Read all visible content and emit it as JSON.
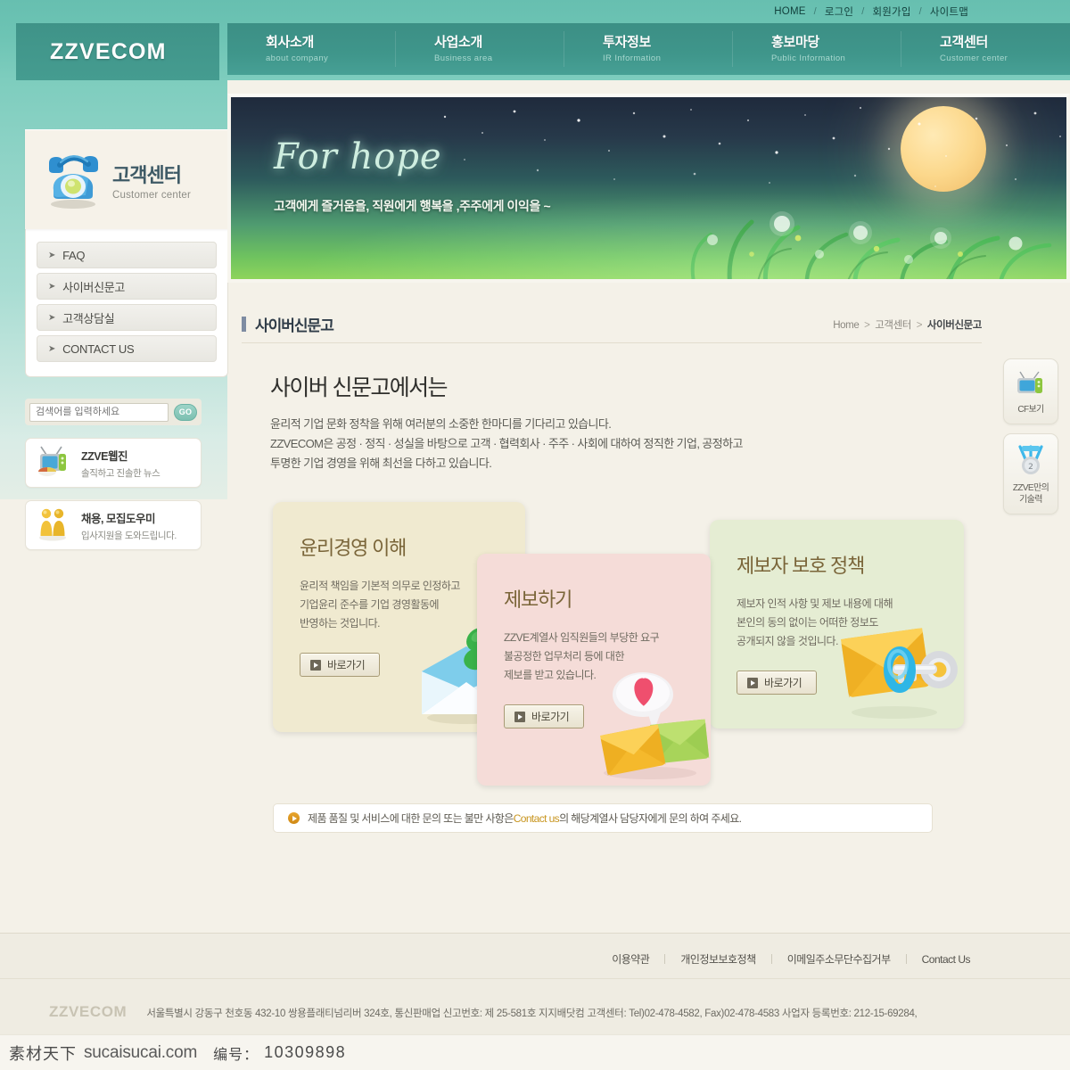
{
  "site": {
    "logo": "ZZVECOM",
    "footer_logo": "ZZVECOM"
  },
  "utility_nav": [
    {
      "label": "HOME"
    },
    {
      "label": "로그인"
    },
    {
      "label": "회원가입"
    },
    {
      "label": "사이트맵"
    }
  ],
  "main_nav": [
    {
      "ko": "회사소개",
      "en": "about company"
    },
    {
      "ko": "사업소개",
      "en": "Business area"
    },
    {
      "ko": "투자정보",
      "en": "IR Information"
    },
    {
      "ko": "홍보마당",
      "en": "Public Information"
    },
    {
      "ko": "고객센터",
      "en": "Customer center"
    }
  ],
  "sidebar": {
    "title_ko": "고객센터",
    "title_en": "Customer center",
    "menu": [
      {
        "label": "FAQ"
      },
      {
        "label": "사이버신문고"
      },
      {
        "label": "고객상담실"
      },
      {
        "label": "CONTACT US"
      }
    ],
    "search": {
      "placeholder": "검색어를 입력하세요",
      "value": "",
      "button": "GO"
    },
    "promos": [
      {
        "title": "ZZVE웹진",
        "subtitle": "솔직하고 진솔한 뉴스",
        "icon": "tv-icon"
      },
      {
        "title": "채용, 모집도우미",
        "subtitle": "입사지원을 도와드립니다.",
        "icon": "people-icon"
      }
    ]
  },
  "banner": {
    "headline": "For hope",
    "subline": "고객에게 즐거움을, 직원에게 행복을 ,주주에게 이익을 ~"
  },
  "page": {
    "title": "사이버신문고",
    "breadcrumb": {
      "home": "Home",
      "mid": "고객센터",
      "current": "사이버신문고",
      "sep": ">"
    }
  },
  "intro": {
    "heading": "사이버 신문고에서는",
    "line1": "윤리적 기업 문화 정착을 위해 여러분의 소중한 한마디를 기다리고 있습니다.",
    "line2": "ZZVECOM은 공정 · 정직 · 성실을 바탕으로 고객 · 협력회사 · 주주 · 사회에 대하여 정직한 기업, 공정하고",
    "line3": "투명한 기업 경영을 위해 최선을 다하고 있습니다."
  },
  "cards": [
    {
      "id": "card-a",
      "heading": "윤리경영 이해",
      "line1": "윤리적 책임을 기본적 의무로 인정하고",
      "line2": "기업윤리 준수를 기업 경영활동에",
      "line3": "반영하는 것입니다.",
      "button": "바로가기",
      "bg": "#f0ead0",
      "art": "envelope-clover-icon"
    },
    {
      "id": "card-b",
      "heading": "제보하기",
      "line1": "ZZVE계열사 임직원들의 부당한 요구",
      "line2": "불공정한 업무처리 등에 대한",
      "line3": "제보를 받고 있습니다.",
      "button": "바로가기",
      "bg": "#f5dcd8",
      "art": "envelopes-heart-icon"
    },
    {
      "id": "card-c",
      "heading": "제보자 보호 정책",
      "line1": "제보자  인적 사항 및 제보 내용에 대해",
      "line2": "본인의 동의 없이는 어떠한 정보도",
      "line3": "공개되지 않을 것입니다.",
      "button": "바로가기",
      "bg": "#e5edd3",
      "art": "envelope-key-icon"
    }
  ],
  "notice": {
    "pre": "제품 품질 및 서비스에 대한 문의 또는 불만 사항은 ",
    "link": "Contact us",
    "post": "의 해당계열사 담당자에게 문의 하여 주세요."
  },
  "quick_buttons": [
    {
      "label": "CF보기",
      "icon": "tv-icon"
    },
    {
      "label": "ZZVE만의\n기술력",
      "label1": "ZZVE만의",
      "label2": "기술력",
      "icon": "medal-icon"
    }
  ],
  "footer": {
    "links": [
      {
        "label": "이용약관"
      },
      {
        "label": "개인정보보호정책"
      },
      {
        "label": "이메일주소무단수집거부"
      },
      {
        "label": "Contact Us"
      }
    ],
    "address": "서울특별시 강동구 천호동 432-10 쌍용플래티넘리버 324호, 통신판매업 신고번호: 제 25-581호 지지배닷컴 고객센터: Tel)02-478-4582, Fax)02-478-4583 사업자 등록번호: 212-15-69284,"
  },
  "watermark": {
    "cn": "素材天下",
    "site": "sucaisucai.com",
    "no_label": "编号：",
    "number": "10309898"
  },
  "colors": {
    "teal_header": "#6dc4b4",
    "teal_dark": "#3f9388",
    "page_bg": "#f4f1e8",
    "accent_gold": "#c8951f",
    "card_a": "#f0ead0",
    "card_b": "#f5dcd8",
    "card_c": "#e5edd3"
  }
}
